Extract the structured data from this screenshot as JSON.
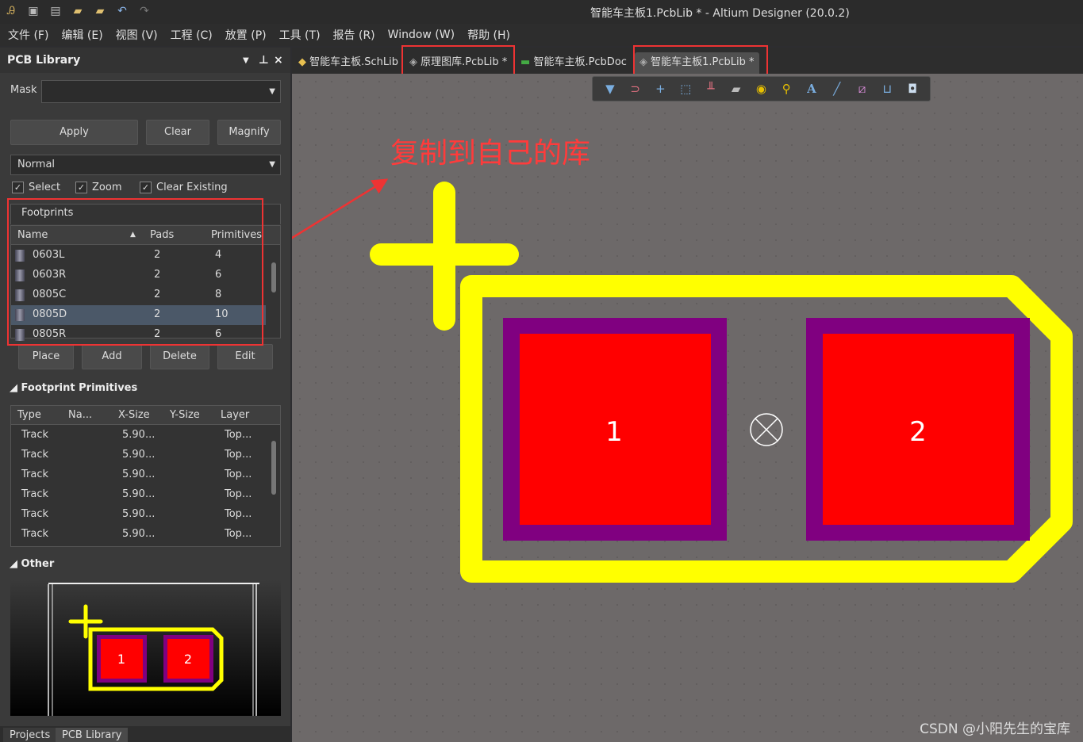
{
  "window": {
    "title": "智能车主板1.PcbLib * - Altium Designer (20.0.2)"
  },
  "menu": [
    "文件 (F)",
    "编辑 (E)",
    "视图 (V)",
    "工程 (C)",
    "放置 (P)",
    "工具 (T)",
    "报告 (R)",
    "Window (W)",
    "帮助 (H)"
  ],
  "panel": {
    "title": "PCB Library",
    "mask_label": "Mask",
    "mask_value": "",
    "apply": "Apply",
    "clear": "Clear",
    "magnify": "Magnify",
    "mode": "Normal",
    "checks": [
      {
        "label": "Select",
        "checked": true
      },
      {
        "label": "Zoom",
        "checked": true
      },
      {
        "label": "Clear Existing",
        "checked": true
      }
    ],
    "footprints_title": "Footprints",
    "fp_cols": [
      "Name",
      "Pads",
      "Primitives"
    ],
    "footprints": [
      {
        "name": "0603L",
        "pads": "2",
        "prims": "4"
      },
      {
        "name": "0603R",
        "pads": "2",
        "prims": "6"
      },
      {
        "name": "0805C",
        "pads": "2",
        "prims": "8"
      },
      {
        "name": "0805D",
        "pads": "2",
        "prims": "10",
        "selected": true
      },
      {
        "name": "0805R",
        "pads": "2",
        "prims": "6"
      }
    ],
    "place": "Place",
    "add": "Add",
    "delete": "Delete",
    "edit": "Edit",
    "prim_title": "Footprint Primitives",
    "prim_cols": [
      "Type",
      "Na...",
      "X-Size",
      "Y-Size",
      "Layer"
    ],
    "primitives": [
      {
        "type": "Track",
        "x": "5.90...",
        "layer": "Top..."
      },
      {
        "type": "Track",
        "x": "5.90...",
        "layer": "Top..."
      },
      {
        "type": "Track",
        "x": "5.90...",
        "layer": "Top..."
      },
      {
        "type": "Track",
        "x": "5.90...",
        "layer": "Top..."
      },
      {
        "type": "Track",
        "x": "5.90...",
        "layer": "Top..."
      },
      {
        "type": "Track",
        "x": "5.90...",
        "layer": "Top..."
      }
    ],
    "other_title": "Other",
    "bottom_tabs": [
      "Projects",
      "PCB Library"
    ]
  },
  "tabs": [
    {
      "label": "智能车主板.SchLib"
    },
    {
      "label": "原理图库.PcbLib *"
    },
    {
      "label": "智能车主板.PcbDoc"
    },
    {
      "label": "智能车主板1.PcbLib *",
      "active": true
    }
  ],
  "toolbar_icons": [
    "filter-icon",
    "interactive-route-icon",
    "cross-icon",
    "select-rect-icon",
    "align-icon",
    "component-icon",
    "pad-icon",
    "via-icon",
    "text-icon",
    "line-icon",
    "dimension-icon",
    "designator-icon",
    "region-icon"
  ],
  "annotation": {
    "text": "复制到自己的库",
    "color": "#ff3b3b"
  },
  "pads": [
    "1",
    "2"
  ],
  "colors": {
    "overlay": "#ffff00",
    "pad": "#ff0000",
    "solder_mask": "#800080",
    "highlight": "#ee3333"
  },
  "watermark": "CSDN @小阳先生的宝库"
}
